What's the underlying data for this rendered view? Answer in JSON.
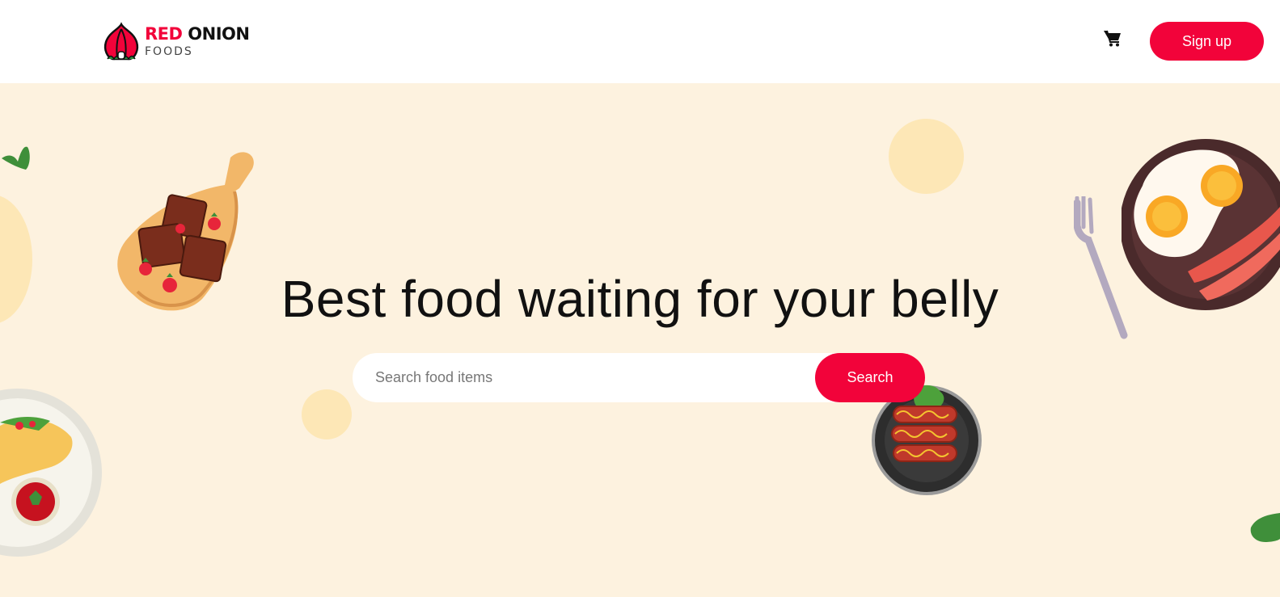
{
  "brand": {
    "name_red": "RED",
    "name_dark": "ONION",
    "subtitle": "FOODS"
  },
  "nav": {
    "signup_label": "Sign up",
    "cart_icon": "shopping-cart-icon"
  },
  "hero": {
    "title": "Best food waiting for your belly",
    "search_placeholder": "Search food items",
    "search_button": "Search"
  },
  "colors": {
    "accent": "#f2033a",
    "hero_bg": "#fdf2df",
    "blob": "#fde7b6"
  }
}
